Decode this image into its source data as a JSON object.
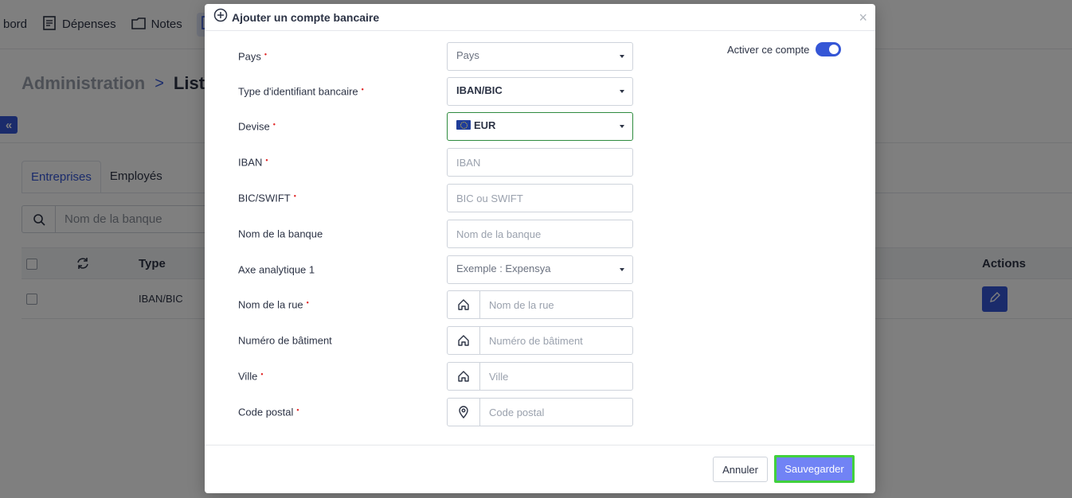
{
  "background": {
    "nav": {
      "item1": "bord",
      "item2": "Dépenses",
      "item3": "Notes"
    },
    "breadcrumb": {
      "parent": "Administration",
      "separator": ">",
      "current": "Liste"
    },
    "tabs": [
      "Entreprises",
      "Employés"
    ],
    "search_placeholder": "Nom de la banque",
    "table": {
      "columns": {
        "type": "Type",
        "actions": "Actions"
      },
      "rows": [
        {
          "type": "IBAN/BIC"
        }
      ]
    }
  },
  "modal": {
    "title": "Ajouter un compte bancaire",
    "close": "×",
    "toggle_label": "Activer ce compte",
    "toggle_on": true,
    "fields": {
      "pays": {
        "label": "Pays",
        "value": "Pays"
      },
      "type_identifiant": {
        "label": "Type d'identifiant bancaire",
        "value": "IBAN/BIC"
      },
      "devise": {
        "label": "Devise",
        "value": "EUR"
      },
      "iban": {
        "label": "IBAN",
        "placeholder": "IBAN"
      },
      "bic": {
        "label": "BIC/SWIFT",
        "placeholder": "BIC ou SWIFT"
      },
      "nom_banque": {
        "label": "Nom de la banque",
        "placeholder": "Nom de la banque"
      },
      "axe": {
        "label": "Axe analytique 1",
        "value": "Exemple : Expensya"
      },
      "rue": {
        "label": "Nom de la rue",
        "placeholder": "Nom de la rue"
      },
      "batiment": {
        "label": "Numéro de bâtiment",
        "placeholder": "Numéro de bâtiment"
      },
      "ville": {
        "label": "Ville",
        "placeholder": "Ville"
      },
      "code_postal": {
        "label": "Code postal",
        "placeholder": "Code postal"
      }
    },
    "required_mark": "•",
    "buttons": {
      "cancel": "Annuler",
      "save": "Sauvegarder"
    }
  },
  "colors": {
    "accent": "#3556d6",
    "required": "#e02424",
    "focus": "#2e8b3e",
    "save_bg": "#7183f5",
    "save_border": "#41d13c"
  }
}
